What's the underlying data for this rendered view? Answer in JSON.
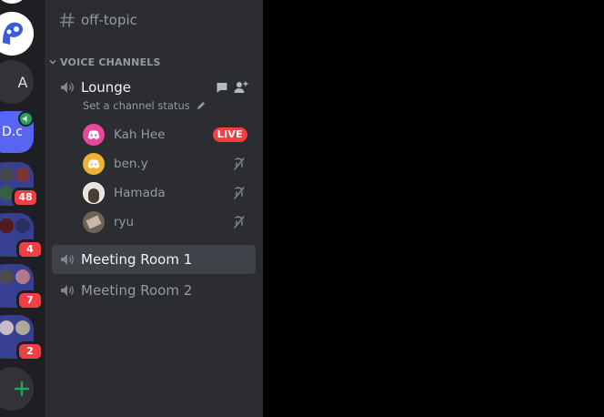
{
  "servers": {
    "a_label": "A",
    "dc_label": "D.c",
    "badges": [
      "48",
      "4",
      "7",
      "2"
    ]
  },
  "channels": {
    "text": {
      "name": "off-topic"
    },
    "category": "VOICE CHANNELS",
    "voice": [
      {
        "name": "Lounge",
        "status_placeholder": "Set a channel status",
        "users": [
          {
            "name": "Kah Hee",
            "live_label": "LIVE",
            "avatar_color": "#eb459e"
          },
          {
            "name": "ben.y",
            "avatar_color": "#f0b232"
          },
          {
            "name": "Hamada"
          },
          {
            "name": "ryu"
          }
        ]
      },
      {
        "name": "Meeting Room 1"
      },
      {
        "name": "Meeting Room 2"
      }
    ]
  },
  "colors": {
    "rail_bg": "#1e1f22",
    "sidebar_bg": "#2b2d31",
    "accent": "#5865f2",
    "badge": "#f23f43",
    "voice_green": "#23a55a"
  }
}
